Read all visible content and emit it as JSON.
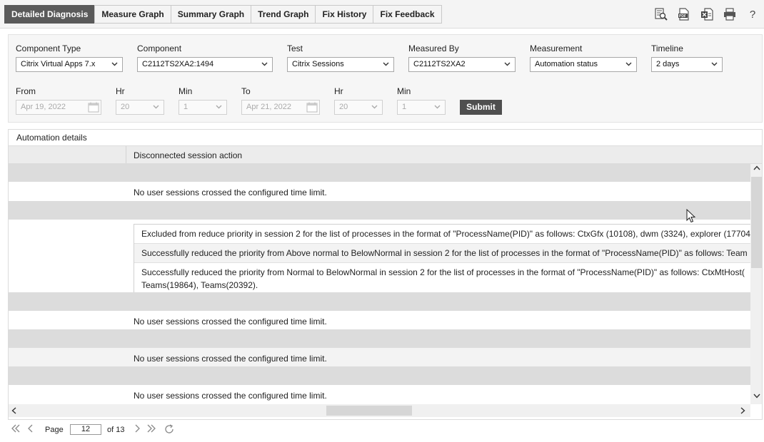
{
  "tabs": [
    {
      "label": "Detailed Diagnosis",
      "active": true
    },
    {
      "label": "Measure Graph"
    },
    {
      "label": "Summary Graph"
    },
    {
      "label": "Trend Graph"
    },
    {
      "label": "Fix History"
    },
    {
      "label": "Fix Feedback"
    }
  ],
  "toolbar": {
    "icons": [
      "search-report-icon",
      "pdf-icon",
      "excel-icon",
      "print-icon",
      "help-icon"
    ],
    "help_label": "?",
    "pdf_label": "PDF"
  },
  "filters": {
    "component_type": {
      "label": "Component Type",
      "value": "Citrix Virtual Apps 7.x"
    },
    "component": {
      "label": "Component",
      "value": "C2112TS2XA2:1494"
    },
    "test": {
      "label": "Test",
      "value": "Citrix Sessions"
    },
    "measured_by": {
      "label": "Measured By",
      "value": "C2112TS2XA2"
    },
    "measurement": {
      "label": "Measurement",
      "value": "Automation status"
    },
    "timeline": {
      "label": "Timeline",
      "value": "2 days"
    },
    "from": {
      "label": "From",
      "value": "Apr 19, 2022"
    },
    "from_hr": {
      "label": "Hr",
      "value": "20"
    },
    "from_min": {
      "label": "Min",
      "value": "1"
    },
    "to": {
      "label": "To",
      "value": "Apr 21, 2022"
    },
    "to_hr": {
      "label": "Hr",
      "value": "20"
    },
    "to_min": {
      "label": "Min",
      "value": "1"
    },
    "submit_label": "Submit"
  },
  "details": {
    "title": "Automation details",
    "column_header": "Disconnected session action",
    "no_sessions_text": "No user sessions crossed the configured time limit.",
    "subrows": [
      "Excluded from reduce priority in session 2 for the list of processes in the format of \"ProcessName(PID)\" as follows: CtxGfx (10108), dwm (3324), explorer (17704",
      "Successfully reduced the priority from Above normal to BelowNormal in session 2 for the list of processes in the format of \"ProcessName(PID)\" as follows: Team",
      "Successfully reduced the priority from Normal to BelowNormal in session 2 for the list of processes in the format of \"ProcessName(PID)\" as follows: CtxMtHost( Teams(19864), Teams(20392)."
    ]
  },
  "pager": {
    "page_label": "Page",
    "page_value": "12",
    "of_label": "of 13"
  },
  "colors": {
    "active_tab": "#5a5a5a",
    "group_row": "#dcdcdc",
    "submit": "#4f4f4f"
  }
}
